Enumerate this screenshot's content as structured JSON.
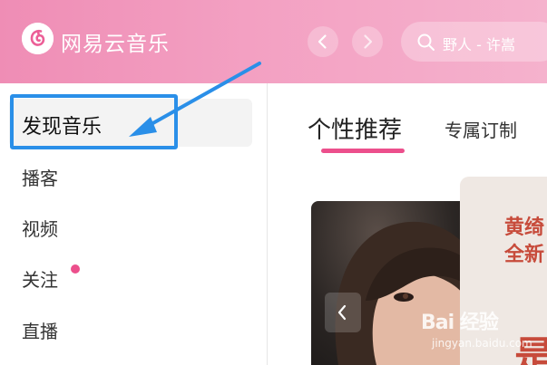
{
  "header": {
    "app_title": "网易云音乐",
    "search": {
      "placeholder": "野人 - 许嵩"
    },
    "icons": {
      "logo": "netease-music-logo-icon",
      "back": "chevron-left-icon",
      "forward": "chevron-right-icon",
      "search": "search-icon"
    }
  },
  "sidebar": {
    "items": [
      {
        "label": "发现音乐",
        "active": true
      },
      {
        "label": "播客"
      },
      {
        "label": "视频"
      },
      {
        "label": "关注",
        "badge_dot": true
      },
      {
        "label": "直播"
      }
    ]
  },
  "main": {
    "tabs": [
      {
        "label": "个性推荐",
        "active": true
      },
      {
        "label": "专属订制"
      }
    ],
    "banner": {
      "line1": "黄绮",
      "line2": "全新",
      "big_char": "是",
      "prev_icon": "chevron-left-icon"
    }
  },
  "watermark": {
    "brand": "Bai 经验",
    "url": "jingyan.baidu.com"
  },
  "colors": {
    "header_gradient_start": "#ef8db5",
    "accent_pink": "#ec4f8c",
    "annotation_blue": "#2a8fe8",
    "banner_text": "#c74b3b"
  }
}
